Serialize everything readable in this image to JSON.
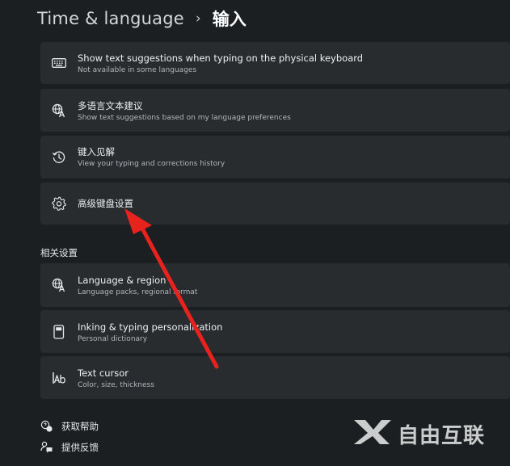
{
  "header": {
    "parent": "Time & language",
    "separator": "›",
    "current": "输入"
  },
  "cards": [
    {
      "icon": "keyboard-icon",
      "title": "Show text suggestions when typing on the physical keyboard",
      "subtitle": "Not available in some languages"
    },
    {
      "icon": "language-icon",
      "title": "多语言文本建议",
      "subtitle": "Show text suggestions based on my language preferences"
    },
    {
      "icon": "history-icon",
      "title": "键入见解",
      "subtitle": "View your typing and corrections history"
    },
    {
      "icon": "gear-icon",
      "title": "高级键盘设置",
      "subtitle": ""
    }
  ],
  "related": {
    "label": "相关设置",
    "cards": [
      {
        "icon": "language-icon",
        "title": "Language & region",
        "subtitle": "Language packs, regional format"
      },
      {
        "icon": "pen-tablet-icon",
        "title": "Inking & typing personalization",
        "subtitle": "Personal dictionary"
      },
      {
        "icon": "text-cursor-icon",
        "title": "Text cursor",
        "subtitle": "Color, size, thickness"
      }
    ]
  },
  "footer": {
    "help": "获取帮助",
    "feedback": "提供反馈"
  },
  "watermark": {
    "text": "自由互联"
  },
  "colors": {
    "background": "#1b1f21",
    "card": "#282c2f",
    "arrow": "#e8221d"
  }
}
